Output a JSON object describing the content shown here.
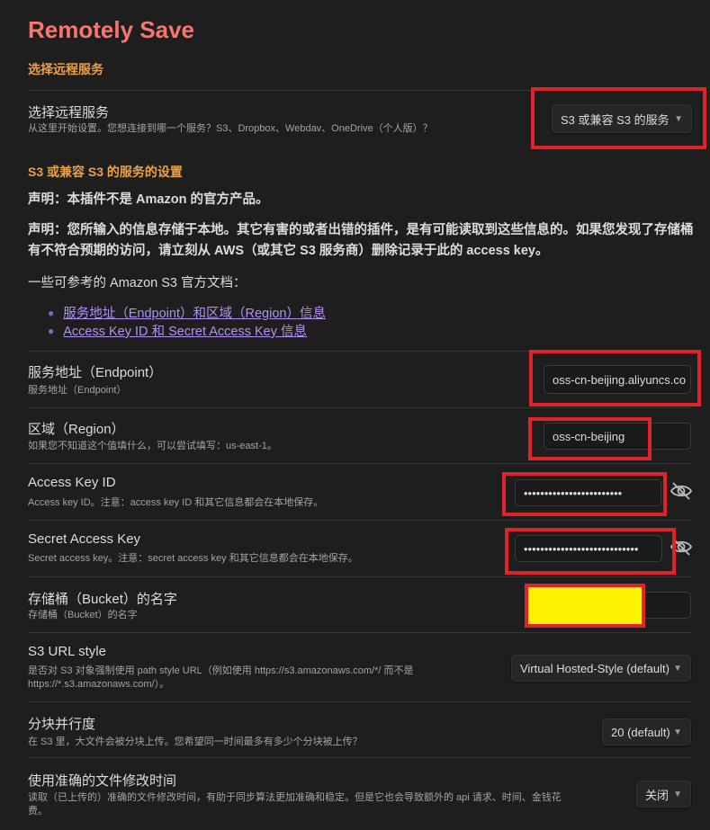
{
  "header": {
    "title": "Remotely Save"
  },
  "sections": {
    "remote_service": "选择远程服务",
    "s3_settings": "S3 或兼容 S3 的服务的设置"
  },
  "service": {
    "name": "选择远程服务",
    "desc": "从这里开始设置。您想连接到哪一个服务？S3、Dropbox、Webdav、OneDrive（个人版）？",
    "selected": "S3 或兼容 S3 的服务"
  },
  "notices": {
    "disclaimer1": "声明：本插件不是 Amazon 的官方产品。",
    "disclaimer2": "声明：您所输入的信息存储于本地。其它有害的或者出错的插件，是有可能读取到这些信息的。如果您发现了存储桶有不符合预期的访问，请立刻从 AWS（或其它 S3 服务商）删除记录于此的 access key。",
    "docs_intro": "一些可参考的 Amazon S3 官方文档：",
    "links": [
      "服务地址（Endpoint）和区域（Region）信息",
      "Access Key ID 和 Secret Access Key 信息"
    ]
  },
  "settings": {
    "endpoint": {
      "name": "服务地址（Endpoint）",
      "desc": "服务地址（Endpoint）",
      "value": "oss-cn-beijing.aliyuncs.co"
    },
    "region": {
      "name": "区域（Region）",
      "desc": "如果您不知道这个值填什么，可以尝试填写：us-east-1。",
      "value": "oss-cn-beijing"
    },
    "access_key_id": {
      "name": "Access Key ID",
      "desc": "Access key ID。注意：access key ID 和其它信息都会在本地保存。",
      "value": "••••••••••••••••••••••••"
    },
    "secret_access_key": {
      "name": "Secret Access Key",
      "desc": "Secret access key。注意：secret access key 和其它信息都会在本地保存。",
      "value": "••••••••••••••••••••••••••••"
    },
    "bucket": {
      "name": "存储桶（Bucket）的名字",
      "desc": "存储桶（Bucket）的名字",
      "value": ""
    },
    "url_style": {
      "name": "S3 URL style",
      "desc1": "是否对 S3 对象强制使用 path style URL（例如使用 https://s3.amazonaws.com/*/ 而不是",
      "desc2": "https://*.s3.amazonaws.com/）。",
      "selected": "Virtual Hosted-Style (default)"
    },
    "parts": {
      "name": "分块并行度",
      "desc": "在 S3 里，大文件会被分块上传。您希望同一时间最多有多少个分块被上传？",
      "selected": "20 (default)"
    },
    "mtime": {
      "name": "使用准确的文件修改时间",
      "desc1": "读取（已上传的）准确的文件修改时间，有助于同步算法更加准确和稳定。但是它也会导致额外的 api 请求、时间、金钱花",
      "desc2": "费。",
      "selected": "关闭"
    }
  },
  "colors": {
    "title": "#f87570",
    "heading": "#e9a04e",
    "link": "#b391f0",
    "annotation": "#e0222a",
    "highlight": "#fff200"
  },
  "icons": {
    "dropdown": "chevron-down-icon",
    "reveal": "eye-off-icon"
  }
}
